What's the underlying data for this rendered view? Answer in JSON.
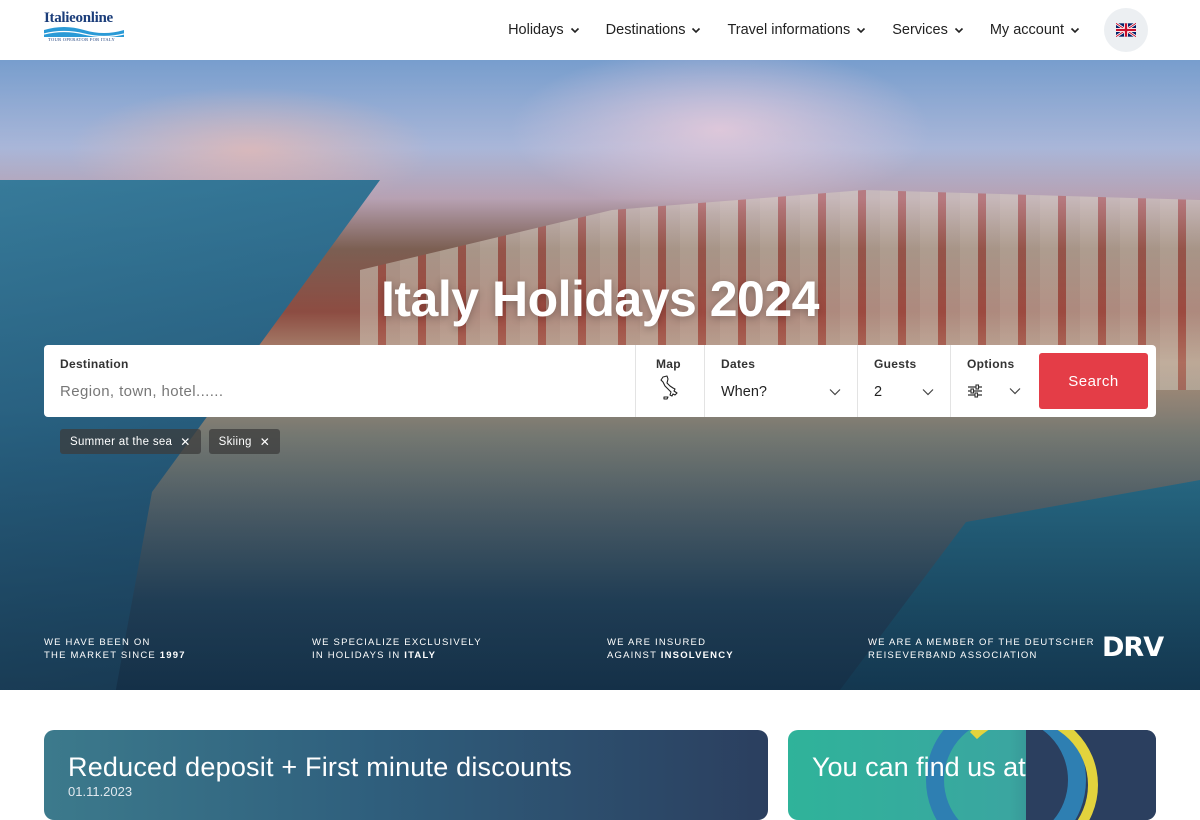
{
  "brand": {
    "name": "Italieonline",
    "tagline": "TOUR OPERATOR FOR ITALY"
  },
  "nav": [
    {
      "label": "Holidays"
    },
    {
      "label": "Destinations"
    },
    {
      "label": "Travel informations"
    },
    {
      "label": "Services"
    },
    {
      "label": "My account"
    }
  ],
  "language": {
    "current": "uk-flag-icon"
  },
  "hero": {
    "title": "Italy Holidays 2024"
  },
  "search": {
    "destination_label": "Destination",
    "destination_placeholder": "Region, town, hotel......",
    "map_label": "Map",
    "dates_label": "Dates",
    "dates_value": "When?",
    "guests_label": "Guests",
    "guests_value": "2",
    "options_label": "Options",
    "button_label": "Search"
  },
  "chips": [
    {
      "label": "Summer at the sea"
    },
    {
      "label": "Skiing"
    }
  ],
  "trust": [
    {
      "line1": "WE HAVE BEEN ON",
      "line2_pre": "THE MARKET SINCE ",
      "line2_bold": "1997"
    },
    {
      "line1": "WE SPECIALIZE EXCLUSIVELY",
      "line2_pre": "IN HOLIDAYS IN ",
      "line2_bold": "ITALY"
    },
    {
      "line1": "WE ARE INSURED",
      "line2_pre": "AGAINST ",
      "line2_bold": "INSOLVENCY"
    },
    {
      "line1": "WE ARE A MEMBER OF THE DEUTSCHER",
      "line2_pre": "REISEVERBAND ASSOCIATION",
      "line2_bold": ""
    }
  ],
  "drv_logo": "DRV",
  "cards": {
    "deposit_title": "Reduced deposit + First minute discounts",
    "deposit_date": "01.11.2023",
    "find_us_title": "You can find us at"
  },
  "colors": {
    "accent": "#e43d47",
    "brand_blue": "#1b3d7a",
    "card_teal": "#2fb39a"
  }
}
